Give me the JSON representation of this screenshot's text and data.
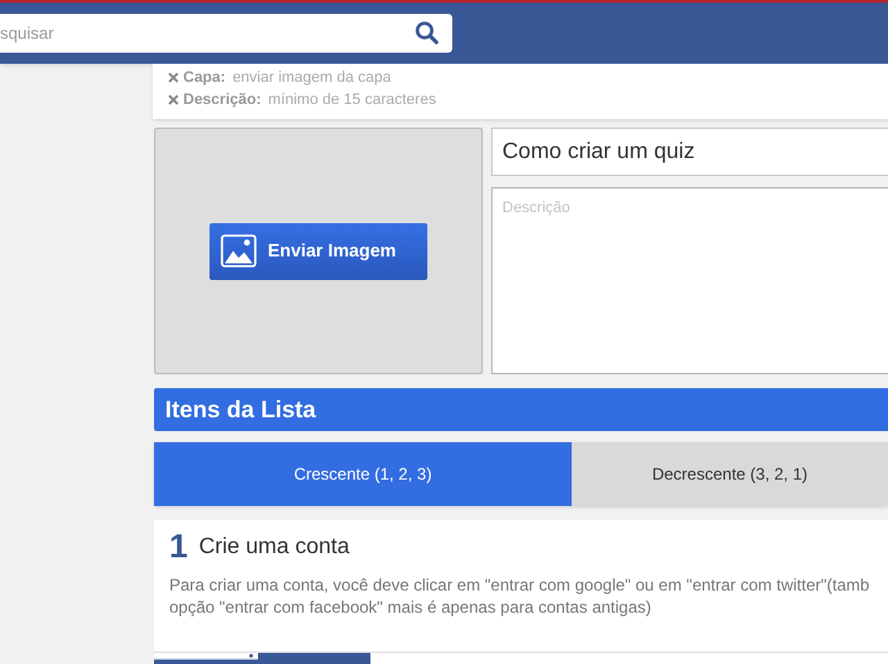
{
  "search": {
    "placeholder": "squisar"
  },
  "validation_errors": [
    {
      "label": "Capa:",
      "message": "enviar imagem da capa"
    },
    {
      "label": "Descrição:",
      "message": "mínimo de 15 caracteres"
    }
  ],
  "cover": {
    "button": "Enviar Imagem"
  },
  "title_field": {
    "value": "Como criar um quiz"
  },
  "description_field": {
    "placeholder": "Descrição"
  },
  "list_section": {
    "title": "Itens da Lista"
  },
  "sort_tabs": [
    {
      "label": "Crescente (1, 2, 3)",
      "selected": true
    },
    {
      "label": "Decrescente (3, 2, 1)",
      "selected": false
    }
  ],
  "items": [
    {
      "number": "1",
      "title": "Crie uma conta",
      "description_lines": [
        "Para criar uma conta, você deve clicar em \"entrar com google\" ou em \"entrar com twitter\"(tamb",
        "opção \"entrar com facebook\" mais é apenas para contas antigas)"
      ]
    }
  ]
}
